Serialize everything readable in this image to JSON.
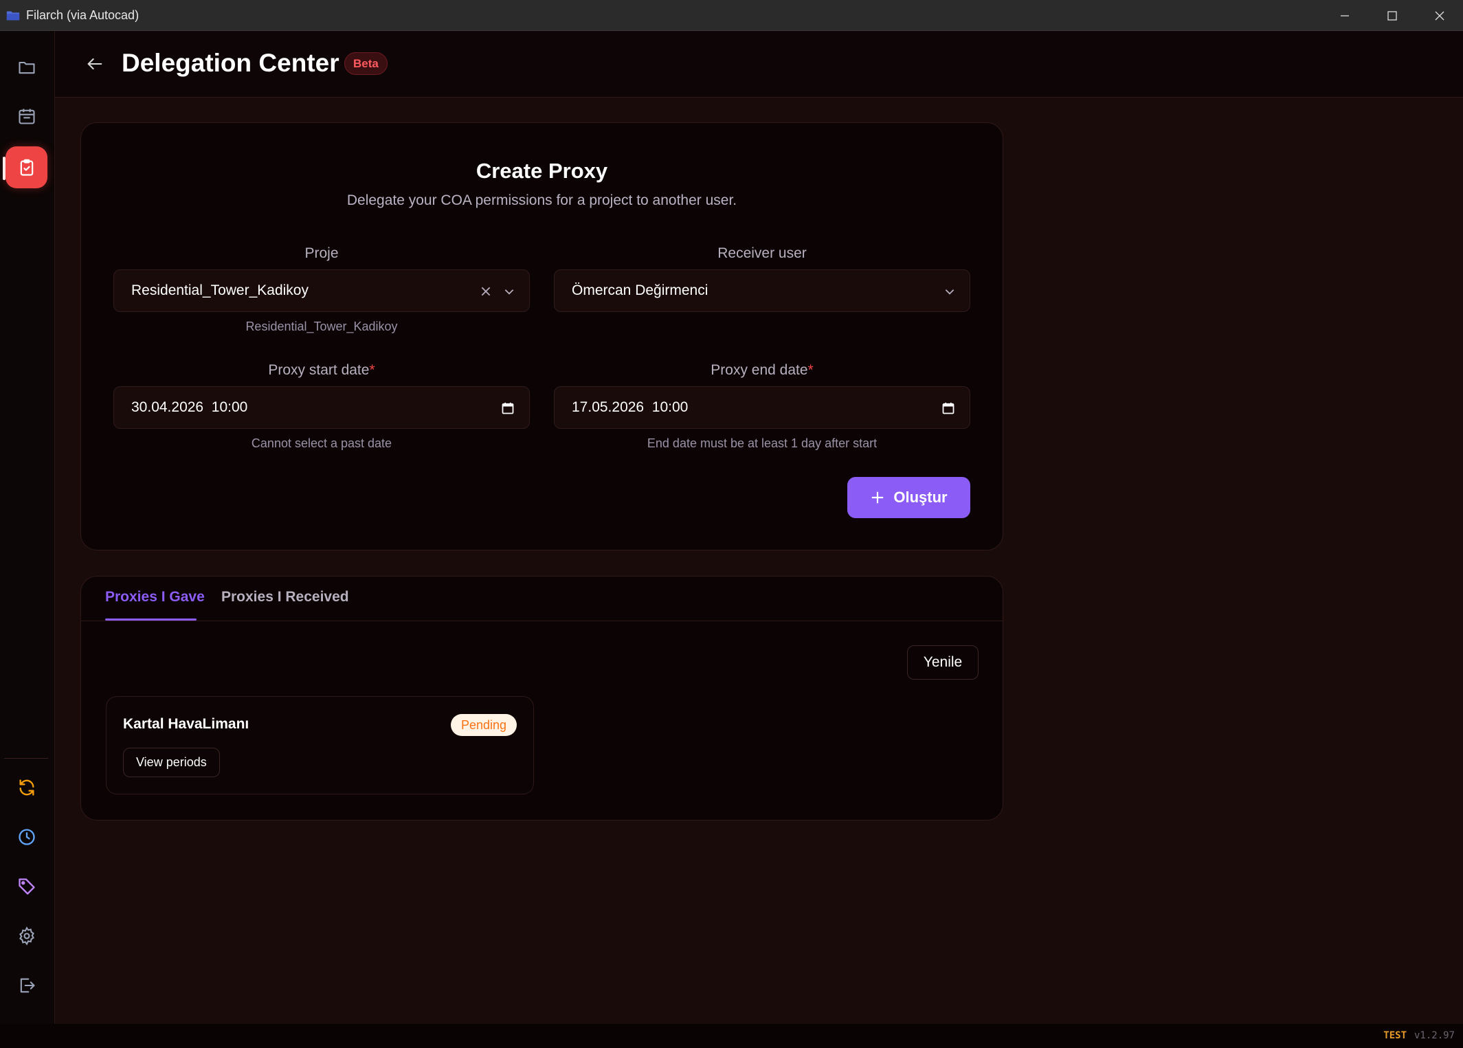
{
  "window": {
    "title": "Filarch (via Autocad)"
  },
  "header": {
    "title": "Delegation Center",
    "badge": "Beta"
  },
  "create": {
    "title": "Create Proxy",
    "subtitle": "Delegate your COA permissions for a project to another user.",
    "project": {
      "label": "Proje",
      "value": "Residential_Tower_Kadikoy",
      "hint": "Residential_Tower_Kadikoy"
    },
    "receiver": {
      "label": "Receiver user",
      "value": "Ömercan Değirmenci"
    },
    "start": {
      "label": "Proxy start date",
      "required": "*",
      "value": "30.04.2026  10:00",
      "hint": "Cannot select a past date"
    },
    "end": {
      "label": "Proxy end date",
      "required": "*",
      "value": "17.05.2026  10:00",
      "hint": "End date must be at least 1 day after start"
    },
    "submit_label": "Oluştur"
  },
  "tabs": {
    "gave": "Proxies I Gave",
    "received": "Proxies I Received",
    "active": "gave"
  },
  "list": {
    "refresh_label": "Yenile",
    "items": [
      {
        "name": "Kartal HavaLimanı",
        "status": "Pending",
        "action": "View periods"
      }
    ]
  },
  "statusbar": {
    "env": "TEST",
    "version": "v1.2.97"
  },
  "colors": {
    "accent": "#8b5cf6",
    "active_nav": "#ef4444",
    "pending": "#f97316"
  }
}
